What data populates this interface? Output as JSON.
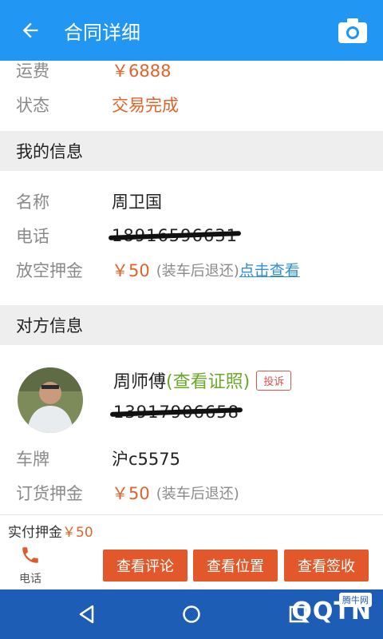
{
  "appbar": {
    "title": "合同详细",
    "back_icon": "arrow-left-icon",
    "camera_icon": "camera-icon",
    "color": "#2196f3"
  },
  "freight": {
    "label": "运费",
    "value": "￥6888"
  },
  "status": {
    "label": "状态",
    "value": "交易完成"
  },
  "my_info": {
    "header": "我的信息",
    "name_label": "名称",
    "name_value": "周卫国",
    "phone_label": "电话",
    "phone_value": "18916596631",
    "deposit_label": "放空押金",
    "deposit_value": "￥50",
    "deposit_hint": "(装车后退还)",
    "deposit_link": "点击查看"
  },
  "other_info": {
    "header": "对方信息",
    "name": "周师傅",
    "cert_link": "(查看证照)",
    "complain": "投诉",
    "phone_value": "13917906658",
    "plate_label": "车牌",
    "plate_value": "沪c5575",
    "order_deposit_label": "订货押金",
    "order_deposit_value": "￥50",
    "order_deposit_hint": "(装车后退还)"
  },
  "footer": {
    "paid_label": "实付押金",
    "paid_value": "￥50",
    "call_label": "电话",
    "buttons": [
      "查看评论",
      "查看位置",
      "查看签收"
    ]
  },
  "navbar": {
    "back": "nav-back-icon",
    "home": "nav-home-icon",
    "recents": "nav-recents-icon"
  },
  "watermark": {
    "text": "QQTN",
    "badge": "腾牛网"
  },
  "colors": {
    "accent": "#e0642a",
    "button": "#e2582b",
    "link": "#2f8fd8",
    "green": "#6aa82a"
  }
}
